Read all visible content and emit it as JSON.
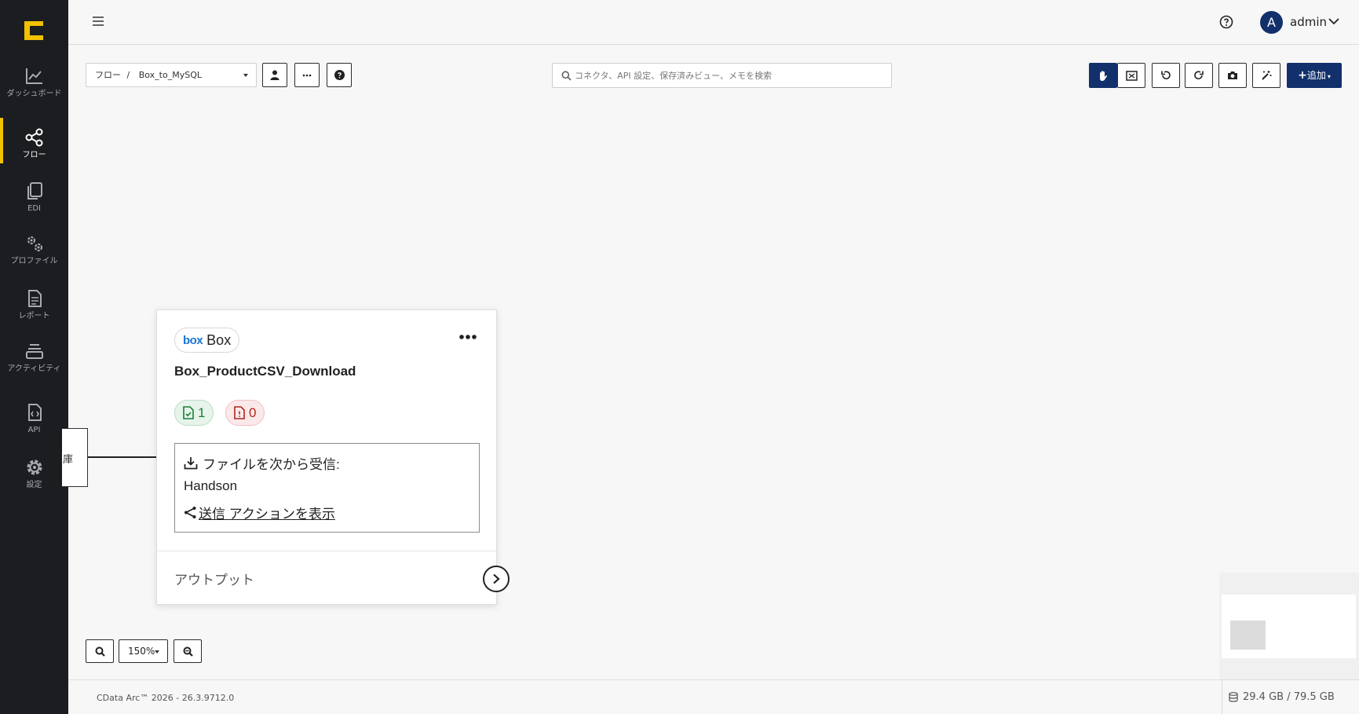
{
  "sidebar": {
    "items": [
      {
        "label": "ダッシュボード",
        "icon": "chart-line-icon"
      },
      {
        "label": "フロー",
        "icon": "share-nodes-icon",
        "active": true
      },
      {
        "label": "EDI",
        "icon": "copy-files-icon"
      },
      {
        "label": "プロファイル",
        "icon": "gears-icon"
      },
      {
        "label": "レポート",
        "icon": "document-icon"
      },
      {
        "label": "アクティビティ",
        "icon": "layers-icon"
      },
      {
        "label": "API",
        "icon": "code-file-icon"
      },
      {
        "label": "設定",
        "icon": "gear-icon"
      }
    ]
  },
  "topbar": {
    "avatar_letter": "A",
    "user_name": "admin"
  },
  "toolbar": {
    "breadcrumb_root": "フロー",
    "breadcrumb_separator": "/",
    "breadcrumb_current": "Box_to_MySQL",
    "search_placeholder": "コネクタ、API 設定、保存済みビュー、メモを検索",
    "add_label": "追加"
  },
  "left_node": {
    "label": "庫"
  },
  "card": {
    "connector_logo": "box",
    "connector_name": "Box",
    "title": "Box_ProductCSV_Download",
    "success_count": "1",
    "error_count": "0",
    "receive_label": "ファイルを次から受信:",
    "receive_source": "Handson",
    "send_action_link": "送信 アクションを表示",
    "output_label": "アウトプット"
  },
  "zoom": {
    "level": "150%"
  },
  "footer": {
    "version": "CData Arc™ 2026 - 26.3.9712.0",
    "storage": "29.4 GB / 79.5 GB"
  },
  "colors": {
    "sidebar_bg": "#1c1d21",
    "accent_yellow": "#f2c200",
    "primary_navy": "#12306b",
    "success_green": "#1a7f37",
    "error_red": "#b3261e"
  }
}
